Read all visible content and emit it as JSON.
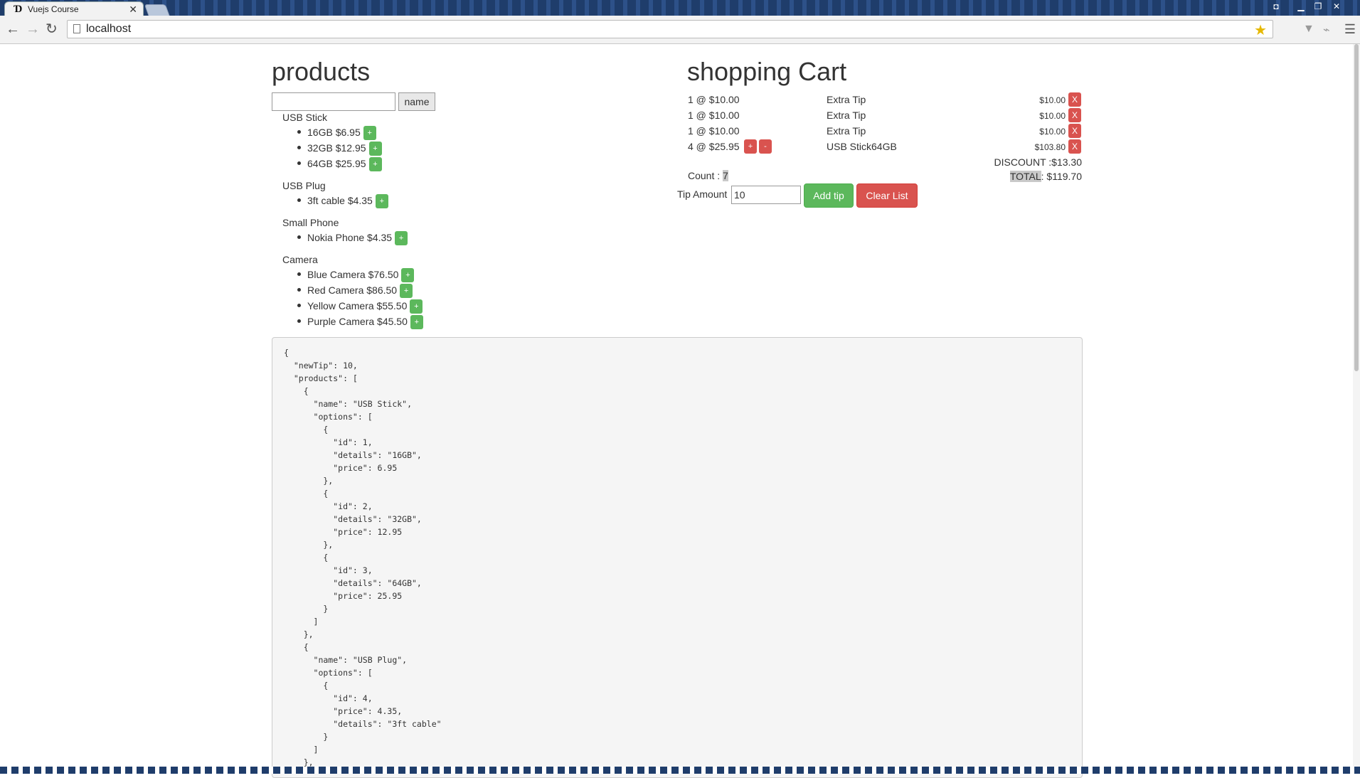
{
  "browser": {
    "tab_title": "Vuejs Course",
    "tab_close": "✕",
    "url": "localhost"
  },
  "products": {
    "title": "products",
    "search_value": "",
    "sort_button": "name",
    "groups": [
      {
        "name": "USB Stick",
        "options": [
          "16GB $6.95",
          "32GB $12.95",
          "64GB $25.95"
        ]
      },
      {
        "name": "USB Plug",
        "options": [
          "3ft cable $4.35"
        ]
      },
      {
        "name": "Small Phone",
        "options": [
          "Nokia Phone $4.35"
        ]
      },
      {
        "name": "Camera",
        "options": [
          "Blue Camera $76.50",
          "Red Camera $86.50",
          "Yellow Camera $55.50",
          "Purple Camera $45.50"
        ]
      }
    ],
    "add_label": "+"
  },
  "cart": {
    "title": "shopping Cart",
    "items": [
      {
        "qty": "1 @ $10.00",
        "name": "Extra Tip",
        "total": "$10.00"
      },
      {
        "qty": "1 @ $10.00",
        "name": "Extra Tip",
        "total": "$10.00"
      },
      {
        "qty": "1 @ $10.00",
        "name": "Extra Tip",
        "total": "$10.00"
      },
      {
        "qty": "4 @ $25.95",
        "name": "USB Stick64GB",
        "total": "$103.80"
      }
    ],
    "remove_label": "X",
    "inc_label": "+",
    "dec_label": "-",
    "discount_text": "DISCOUNT :$13.30",
    "total_label": "TOTAL",
    "total_value": ": $119.70",
    "count_label": "Count : ",
    "count_value": "7",
    "tip_label": "Tip Amount",
    "tip_value": "10",
    "add_tip": "Add tip",
    "clear_list": "Clear List"
  },
  "debug_json": "{\n  \"newTip\": 10,\n  \"products\": [\n    {\n      \"name\": \"USB Stick\",\n      \"options\": [\n        {\n          \"id\": 1,\n          \"details\": \"16GB\",\n          \"price\": 6.95\n        },\n        {\n          \"id\": 2,\n          \"details\": \"32GB\",\n          \"price\": 12.95\n        },\n        {\n          \"id\": 3,\n          \"details\": \"64GB\",\n          \"price\": 25.95\n        }\n      ]\n    },\n    {\n      \"name\": \"USB Plug\",\n      \"options\": [\n        {\n          \"id\": 4,\n          \"price\": 4.35,\n          \"details\": \"3ft cable\"\n        }\n      ]\n    },"
}
